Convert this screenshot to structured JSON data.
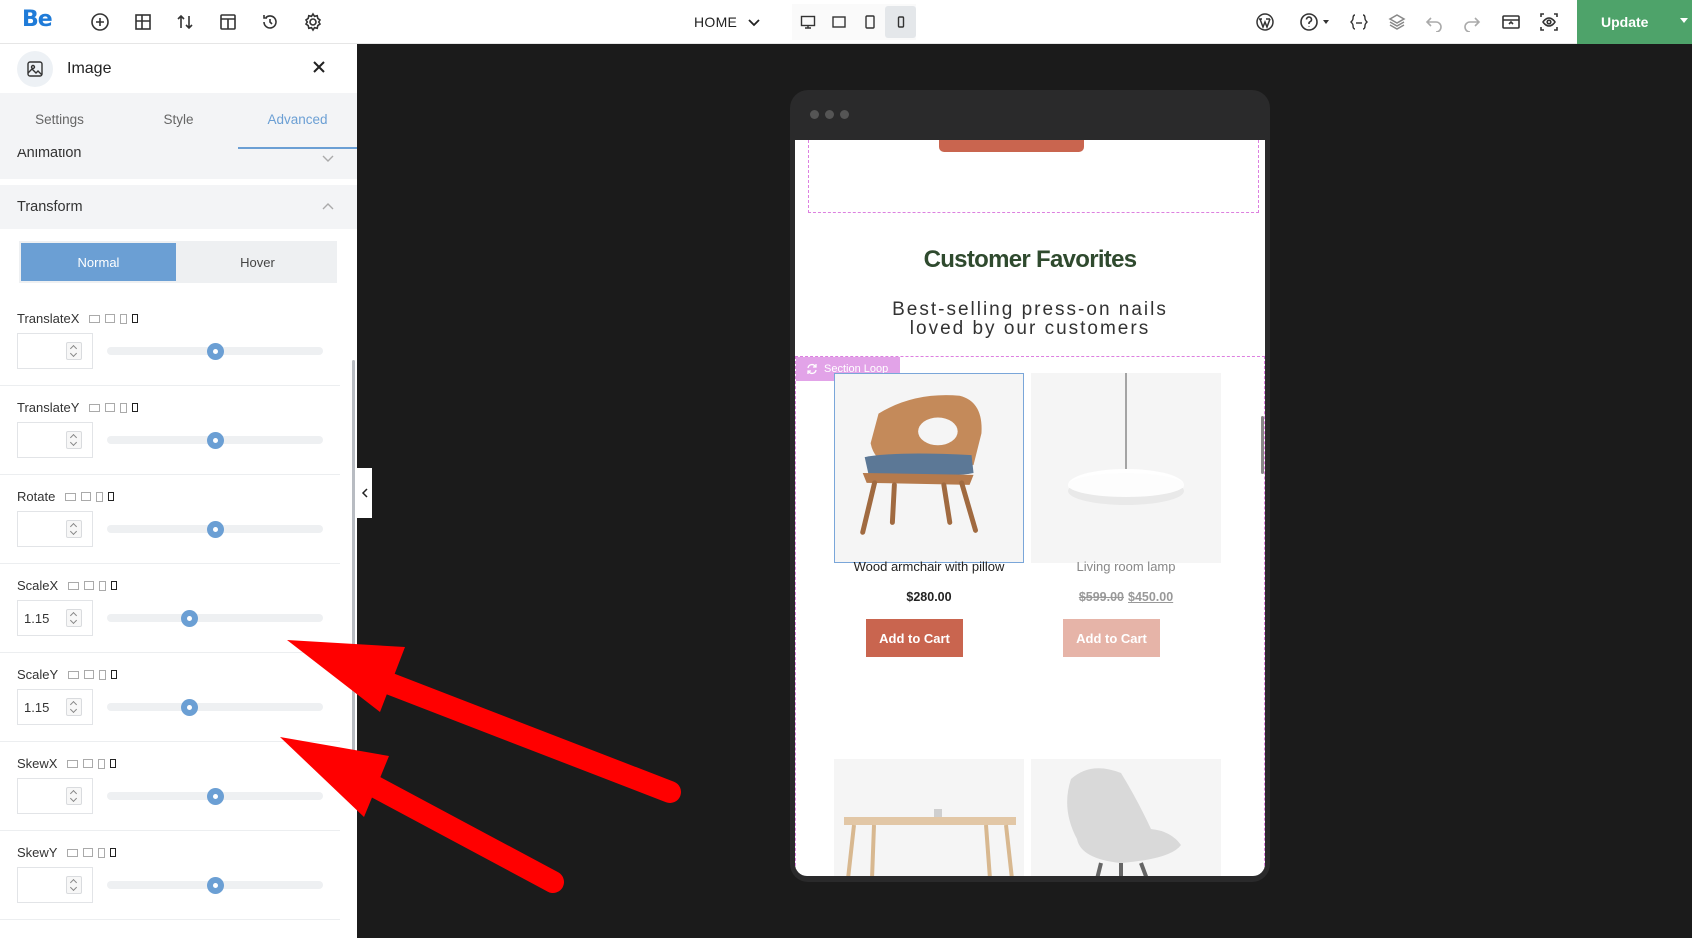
{
  "app": {
    "logo": "Be"
  },
  "toolbar": {
    "icons": [
      "add-icon",
      "layout-icon",
      "sort-icon",
      "template-icon",
      "history-icon",
      "settings-icon"
    ],
    "page_name": "HOME",
    "devices": [
      "desktop-icon",
      "laptop-icon",
      "tablet-icon",
      "mobile-icon"
    ],
    "active_device": "mobile-icon",
    "right_icons": [
      "wordpress-icon",
      "help-icon",
      "css-icon",
      "layers-icon",
      "undo-icon",
      "redo-icon",
      "preview-icon",
      "view-icon"
    ],
    "update_label": "Update"
  },
  "panel": {
    "element_name": "Image",
    "tabs": [
      {
        "label": "Settings",
        "active": false
      },
      {
        "label": "Style",
        "active": false
      },
      {
        "label": "Advanced",
        "active": true
      }
    ],
    "sections": {
      "animation": "Animation",
      "transform": "Transform"
    },
    "state_toggle": {
      "normal": "Normal",
      "hover": "Hover",
      "active": "Normal"
    },
    "controls": [
      {
        "label": "TranslateX",
        "value": "",
        "slider": 0.5
      },
      {
        "label": "TranslateY",
        "value": "",
        "slider": 0.5
      },
      {
        "label": "Rotate",
        "value": "",
        "slider": 0.5
      },
      {
        "label": "ScaleX",
        "value": "1.15",
        "slider": 0.38
      },
      {
        "label": "ScaleY",
        "value": "1.15",
        "slider": 0.38
      },
      {
        "label": "SkewX",
        "value": "",
        "slider": 0.5
      },
      {
        "label": "SkewY",
        "value": "",
        "slider": 0.5
      }
    ]
  },
  "preview": {
    "section_title": "Customer Favorites",
    "section_subtitle": "Best-selling press-on nails loved by our customers",
    "loop_badge": "Section Loop",
    "products": [
      {
        "name": "Wood armchair with pillow",
        "price": "$280.00",
        "old_price": "",
        "cart_label": "Add to Cart",
        "selected": true
      },
      {
        "name": "Living room lamp",
        "price": "$450.00",
        "old_price": "$599.00",
        "cart_label": "Add to Cart",
        "selected": false
      }
    ]
  },
  "colors": {
    "accent": "#6b9fd4",
    "update": "#4ea36a",
    "cart": "#c9654f",
    "loop_border": "#dd80e0",
    "annotation_arrow": "#ff0000"
  }
}
